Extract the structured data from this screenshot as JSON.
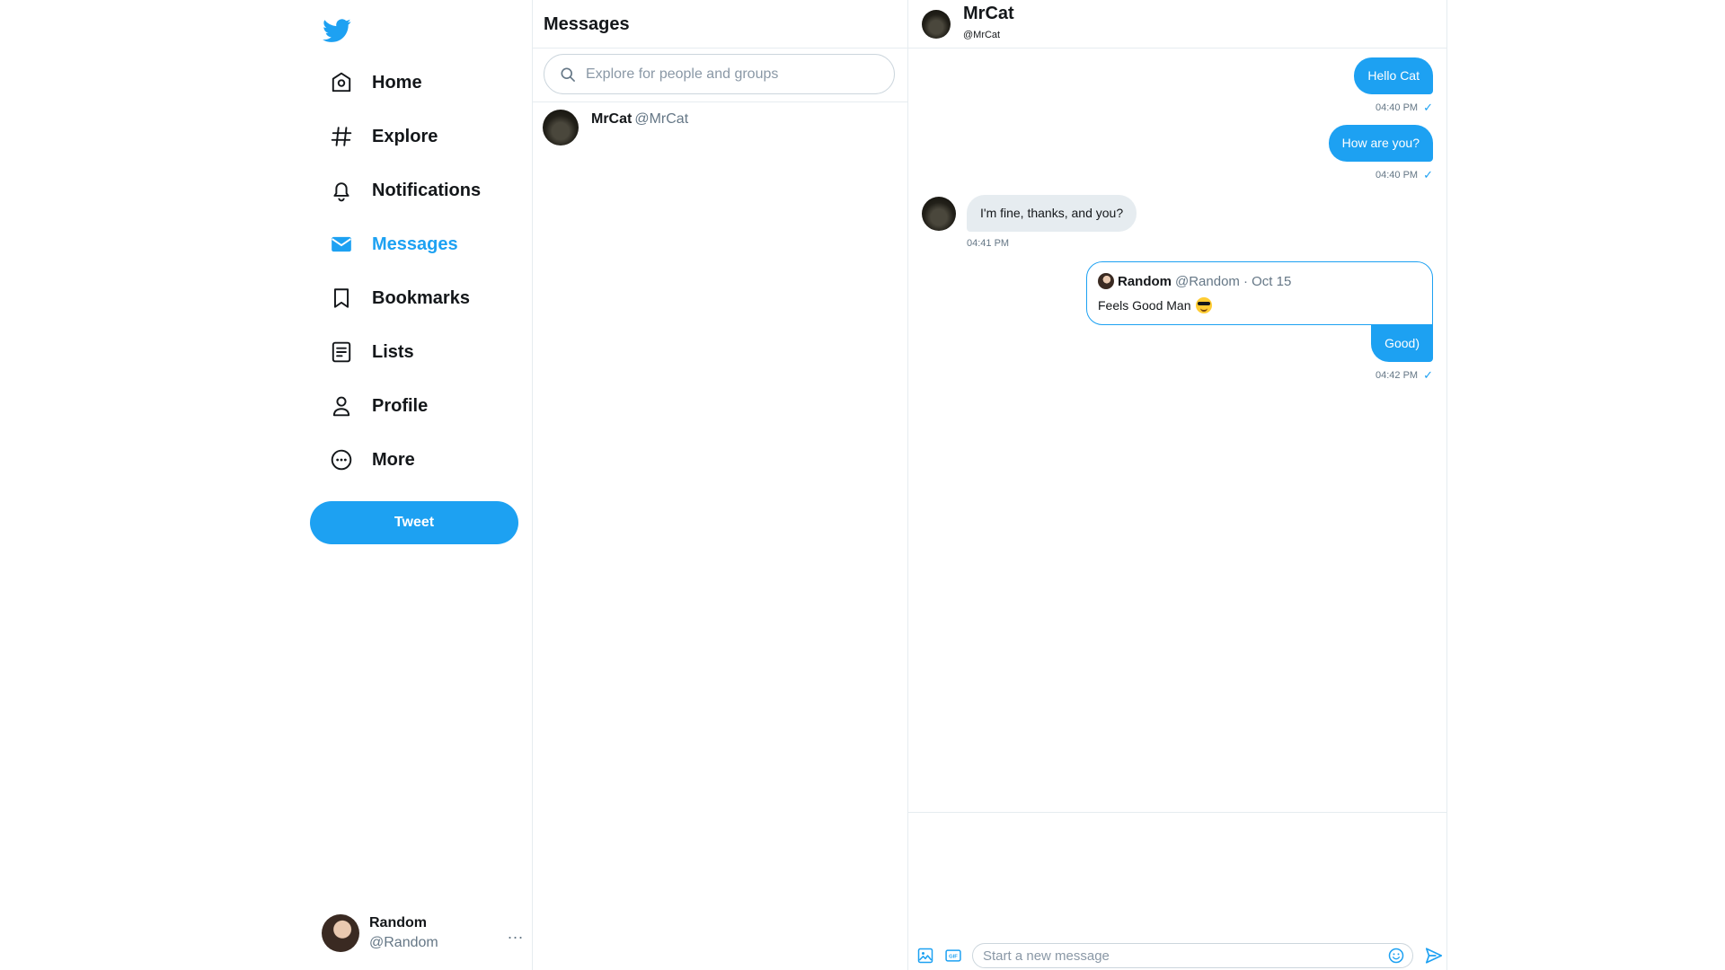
{
  "colors": {
    "accent": "#1da1f2",
    "text": "#14171a",
    "muted": "#657786",
    "border": "#e6ecf0"
  },
  "sidebar": {
    "logo_icon": "twitter-bird-icon",
    "items": [
      {
        "label": "Home",
        "icon": "home-icon"
      },
      {
        "label": "Explore",
        "icon": "hashtag-icon"
      },
      {
        "label": "Notifications",
        "icon": "bell-icon"
      },
      {
        "label": "Messages",
        "icon": "envelope-icon",
        "active": true
      },
      {
        "label": "Bookmarks",
        "icon": "bookmark-icon"
      },
      {
        "label": "Lists",
        "icon": "list-icon"
      },
      {
        "label": "Profile",
        "icon": "person-icon"
      },
      {
        "label": "More",
        "icon": "more-circle-icon"
      }
    ],
    "tweet_label": "Tweet",
    "account": {
      "name": "Random",
      "handle": "@Random",
      "menu": "..."
    }
  },
  "conversations": {
    "title": "Messages",
    "search_placeholder": "Explore for people and groups",
    "items": [
      {
        "name": "MrCat",
        "handle": "@MrCat"
      }
    ]
  },
  "chat": {
    "header": {
      "name": "MrCat",
      "handle": "@MrCat"
    },
    "messages": [
      {
        "direction": "out",
        "text": "Hello Cat",
        "time": "04:40 PM"
      },
      {
        "direction": "out",
        "text": "How are you?",
        "time": "04:40 PM"
      },
      {
        "direction": "in",
        "text": "I'm fine, thanks, and you?",
        "time": "04:41 PM"
      },
      {
        "direction": "out",
        "text": "Good)",
        "time": "04:42 PM",
        "quote": {
          "name": "Random",
          "handle": "@Random",
          "date": "· Oct 15",
          "text": "Feels Good Man"
        }
      }
    ],
    "composer": {
      "placeholder": "Start a new message"
    }
  }
}
